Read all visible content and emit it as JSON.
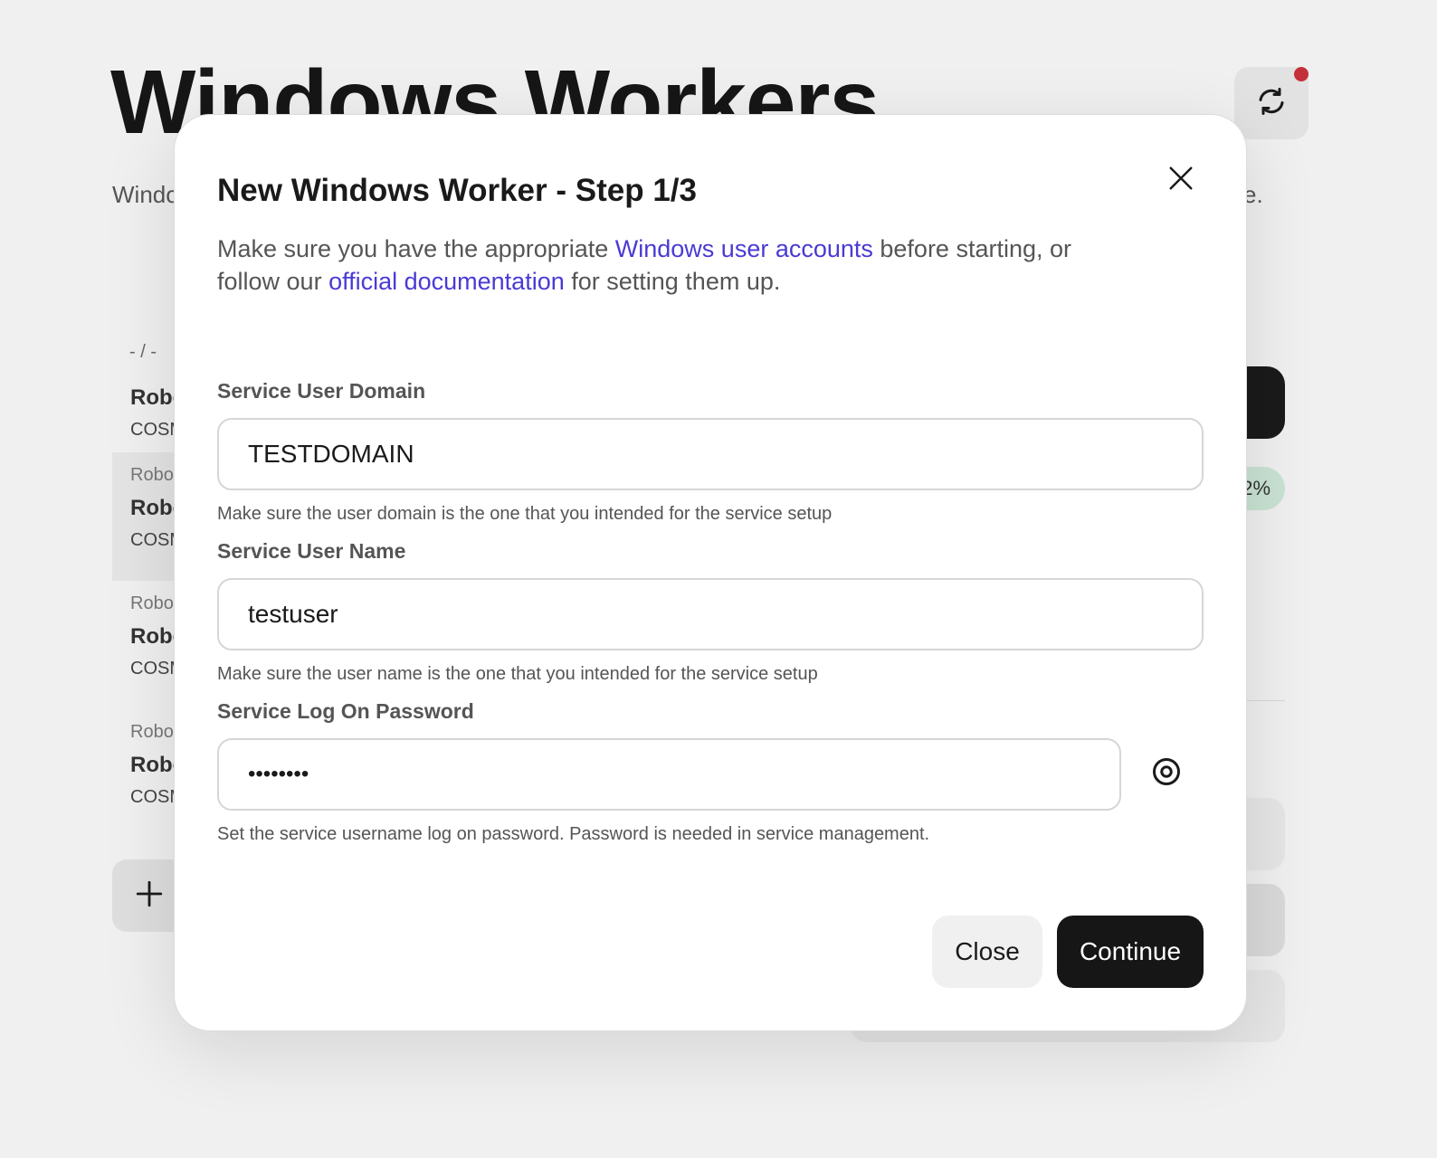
{
  "background": {
    "title": "Windows Workers",
    "subtitle_start": "Windo",
    "subtitle_end": "e.",
    "breadcrumb": "- / -",
    "list": [
      {
        "kind": "",
        "name": "Robo",
        "sub": "COSM"
      },
      {
        "kind": "Robo",
        "name": "Robo",
        "sub": "COSM"
      },
      {
        "kind": "Robo",
        "name": "Robo",
        "sub": "COSM"
      },
      {
        "kind": "Robo",
        "name": "Robo",
        "sub": "COSM"
      }
    ],
    "percent_badge": "2%",
    "accent_dot_color": "#c4303a"
  },
  "modal": {
    "title": "New Windows Worker - Step 1/3",
    "intro": {
      "part1": "Make sure you have the appropriate ",
      "link1": "Windows user accounts",
      "part2": " before starting, or follow our ",
      "link2": "official documentation",
      "part3": " for setting them up."
    },
    "domain": {
      "label": "Service User Domain",
      "value": "TESTDOMAIN",
      "help": "Make sure the user domain is the one that you intended for the service setup"
    },
    "username": {
      "label": "Service User Name",
      "value": "testuser",
      "help": "Make sure the user name is the one that you intended for the service setup"
    },
    "password": {
      "label": "Service Log On Password",
      "value": "••••••••",
      "help": "Set the service username log on password. Password is needed in service management."
    },
    "buttons": {
      "close": "Close",
      "continue": "Continue"
    },
    "link_color": "#4a3ad4"
  }
}
